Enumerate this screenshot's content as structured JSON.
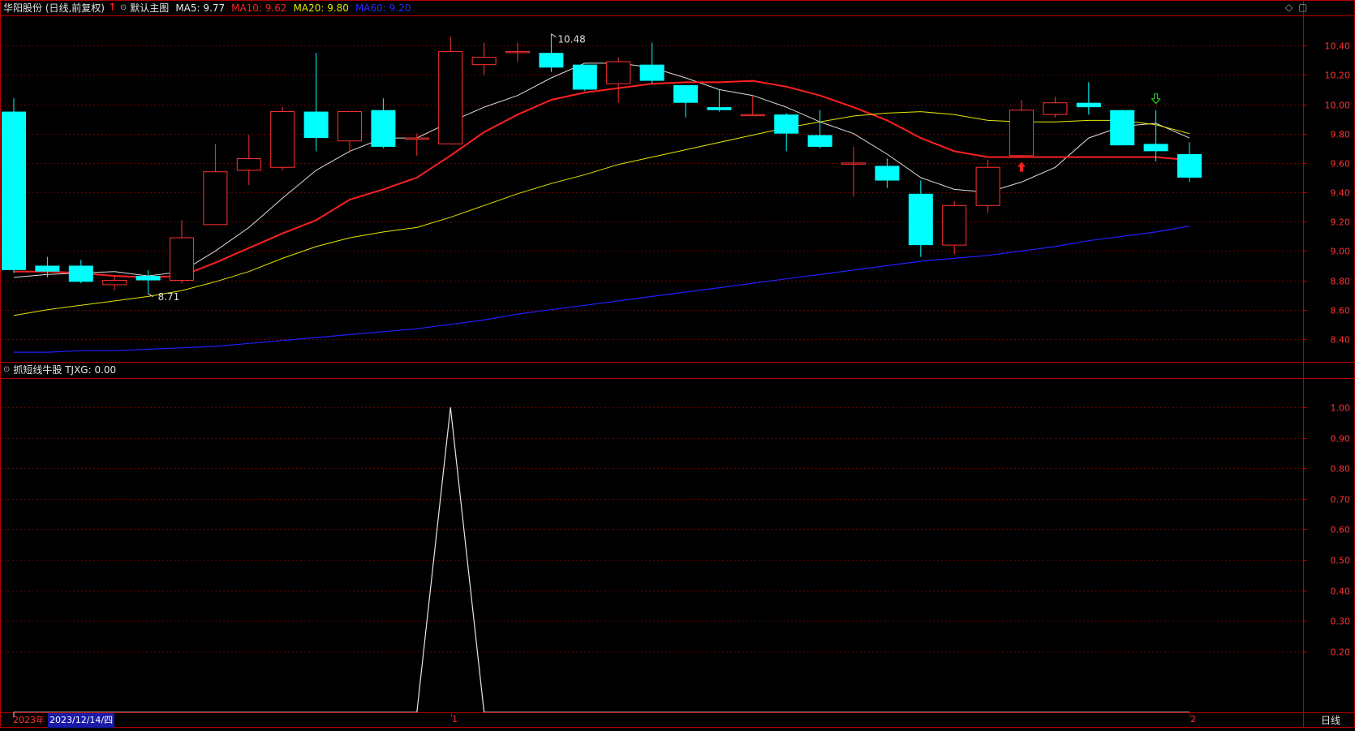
{
  "main_header": {
    "stock": "华阳股份 (日线,前复权)",
    "indicator_name": "默认主图",
    "ma5": "MA5: 9.77",
    "ma10": "MA10: 9.62",
    "ma20": "MA20: 9.80",
    "ma60": "MA60: 9.20"
  },
  "sub_header": {
    "indicator": "抓短线牛股  TJXG: 0.00"
  },
  "annotations": {
    "high": "10.48",
    "low": "8.71"
  },
  "footer": {
    "year": "2023年",
    "cursor_date": "2023/12/14/四",
    "month1": "1",
    "month2": "2",
    "period": "日线"
  },
  "colors": {
    "up": "#ff3232",
    "down": "#00ffff",
    "ma5": "#dddddd",
    "ma10": "#ff2020",
    "ma20": "#e6e600",
    "ma60": "#2020ff",
    "grid": "#6e0000",
    "axis": "#b40000"
  },
  "chart_data": [
    {
      "type": "candlestick",
      "title": "华阳股份 (日线,前复权)",
      "ylim": [
        8.25,
        10.6
      ],
      "y_ticks": [
        10.4,
        10.2,
        10.0,
        9.8,
        9.6,
        9.4,
        9.2,
        9.0,
        8.8,
        8.6,
        8.4
      ],
      "candles": [
        {
          "o": 9.95,
          "h": 10.04,
          "l": 8.85,
          "c": 8.87
        },
        {
          "o": 8.9,
          "h": 8.96,
          "l": 8.82,
          "c": 8.86
        },
        {
          "o": 8.9,
          "h": 8.94,
          "l": 8.78,
          "c": 8.79
        },
        {
          "o": 8.77,
          "h": 8.83,
          "l": 8.73,
          "c": 8.8
        },
        {
          "o": 8.83,
          "h": 8.87,
          "l": 8.71,
          "c": 8.8
        },
        {
          "o": 8.8,
          "h": 9.21,
          "l": 8.78,
          "c": 9.09
        },
        {
          "o": 9.18,
          "h": 9.73,
          "l": 9.18,
          "c": 9.54
        },
        {
          "o": 9.55,
          "h": 9.79,
          "l": 9.45,
          "c": 9.63
        },
        {
          "o": 9.57,
          "h": 9.98,
          "l": 9.55,
          "c": 9.95
        },
        {
          "o": 9.95,
          "h": 10.35,
          "l": 9.68,
          "c": 9.77
        },
        {
          "o": 9.75,
          "h": 9.95,
          "l": 9.67,
          "c": 9.95
        },
        {
          "o": 9.96,
          "h": 10.04,
          "l": 9.7,
          "c": 9.71
        },
        {
          "o": 9.77,
          "h": 9.8,
          "l": 9.65,
          "c": 9.77
        },
        {
          "o": 9.73,
          "h": 10.46,
          "l": 9.73,
          "c": 10.36
        },
        {
          "o": 10.27,
          "h": 10.42,
          "l": 10.2,
          "c": 10.32
        },
        {
          "o": 10.36,
          "h": 10.42,
          "l": 10.29,
          "c": 10.36
        },
        {
          "o": 10.35,
          "h": 10.48,
          "l": 10.22,
          "c": 10.25
        },
        {
          "o": 10.27,
          "h": 10.27,
          "l": 10.09,
          "c": 10.1
        },
        {
          "o": 10.14,
          "h": 10.32,
          "l": 10.01,
          "c": 10.29
        },
        {
          "o": 10.27,
          "h": 10.42,
          "l": 10.14,
          "c": 10.16
        },
        {
          "o": 10.13,
          "h": 10.13,
          "l": 9.91,
          "c": 10.01
        },
        {
          "o": 9.98,
          "h": 10.1,
          "l": 9.95,
          "c": 9.96
        },
        {
          "o": 9.93,
          "h": 10.06,
          "l": 9.93,
          "c": 9.93
        },
        {
          "o": 9.93,
          "h": 9.94,
          "l": 9.68,
          "c": 9.8
        },
        {
          "o": 9.79,
          "h": 9.96,
          "l": 9.7,
          "c": 9.71
        },
        {
          "o": 9.6,
          "h": 9.71,
          "l": 9.37,
          "c": 9.6
        },
        {
          "o": 9.58,
          "h": 9.63,
          "l": 9.43,
          "c": 9.48
        },
        {
          "o": 9.39,
          "h": 9.48,
          "l": 8.96,
          "c": 9.04
        },
        {
          "o": 9.04,
          "h": 9.34,
          "l": 8.98,
          "c": 9.31
        },
        {
          "o": 9.31,
          "h": 9.62,
          "l": 9.26,
          "c": 9.57
        },
        {
          "o": 9.65,
          "h": 10.03,
          "l": 9.64,
          "c": 9.96
        },
        {
          "o": 9.93,
          "h": 10.05,
          "l": 9.91,
          "c": 10.01
        },
        {
          "o": 10.01,
          "h": 10.15,
          "l": 9.93,
          "c": 9.98
        },
        {
          "o": 9.96,
          "h": 9.96,
          "l": 9.72,
          "c": 9.72
        },
        {
          "o": 9.73,
          "h": 9.96,
          "l": 9.61,
          "c": 9.68
        },
        {
          "o": 9.66,
          "h": 9.74,
          "l": 9.47,
          "c": 9.5
        }
      ],
      "series": [
        {
          "name": "MA5",
          "values": [
            8.82,
            8.84,
            8.85,
            8.86,
            8.83,
            8.86,
            9.0,
            9.16,
            9.36,
            9.55,
            9.68,
            9.77,
            9.77,
            9.88,
            9.98,
            10.06,
            10.18,
            10.28,
            10.28,
            10.25,
            10.18,
            10.1,
            10.06,
            9.98,
            9.88,
            9.8,
            9.66,
            9.5,
            9.42,
            9.4,
            9.47,
            9.57,
            9.77,
            9.85,
            9.87,
            9.77
          ]
        },
        {
          "name": "MA10",
          "values": [
            8.86,
            8.86,
            8.85,
            8.83,
            8.82,
            8.83,
            8.92,
            9.02,
            9.12,
            9.21,
            9.35,
            9.42,
            9.5,
            9.65,
            9.81,
            9.93,
            10.03,
            10.08,
            10.11,
            10.14,
            10.15,
            10.15,
            10.16,
            10.12,
            10.06,
            9.98,
            9.89,
            9.77,
            9.68,
            9.64,
            9.64,
            9.64,
            9.64,
            9.64,
            9.64,
            9.62
          ]
        },
        {
          "name": "MA20",
          "values": [
            8.56,
            8.6,
            8.63,
            8.66,
            8.69,
            8.73,
            8.79,
            8.86,
            8.95,
            9.03,
            9.09,
            9.13,
            9.16,
            9.23,
            9.31,
            9.39,
            9.46,
            9.52,
            9.59,
            9.64,
            9.69,
            9.74,
            9.79,
            9.84,
            9.88,
            9.92,
            9.94,
            9.95,
            9.93,
            9.89,
            9.88,
            9.88,
            9.89,
            9.89,
            9.86,
            9.8
          ]
        },
        {
          "name": "MA60",
          "values": [
            8.31,
            8.31,
            8.32,
            8.32,
            8.33,
            8.34,
            8.35,
            8.37,
            8.39,
            8.41,
            8.43,
            8.45,
            8.47,
            8.5,
            8.53,
            8.57,
            8.6,
            8.63,
            8.66,
            8.69,
            8.72,
            8.75,
            8.78,
            8.81,
            8.84,
            8.87,
            8.9,
            8.93,
            8.95,
            8.97,
            9.0,
            9.03,
            9.07,
            9.1,
            9.13,
            9.17
          ]
        }
      ],
      "signals": [
        {
          "index": 30,
          "kind": "buy"
        },
        {
          "index": 34,
          "kind": "sell"
        }
      ]
    },
    {
      "type": "line",
      "title": "抓短线牛股",
      "ylim": [
        0,
        1.08
      ],
      "y_ticks": [
        1.0,
        0.9,
        0.8,
        0.7,
        0.6,
        0.5,
        0.4,
        0.3,
        0.2
      ],
      "series": [
        {
          "name": "TJXG",
          "values": [
            0,
            0,
            0,
            0,
            0,
            0,
            0,
            0,
            0,
            0,
            0,
            0,
            0,
            1,
            0,
            0,
            0,
            0,
            0,
            0,
            0,
            0,
            0,
            0,
            0,
            0,
            0,
            0,
            0,
            0,
            0,
            0,
            0,
            0,
            0,
            0
          ]
        }
      ]
    }
  ]
}
